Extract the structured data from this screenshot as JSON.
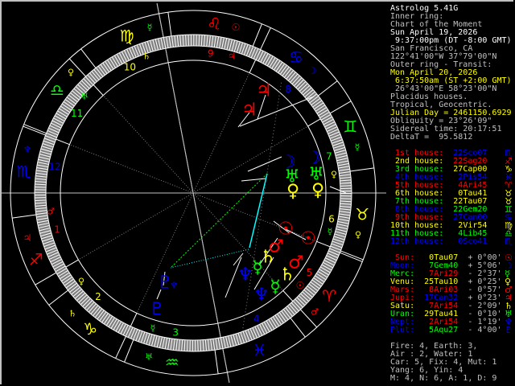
{
  "info": [
    {
      "text": "Astrolog 5.41G",
      "color": "#ffffff"
    },
    {
      "text": "Inner ring:",
      "color": "#c0c0c0"
    },
    {
      "text": "Chart of the Moment",
      "color": "#c0c0c0"
    },
    {
      "text": "Sun April 19, 2026",
      "color": "#ffffff"
    },
    {
      "text": " 9:37:00pm (DT -8:00 GMT)",
      "color": "#ffffff"
    },
    {
      "text": "San Francisco, CA",
      "color": "#c0c0c0"
    },
    {
      "text": "122°41'00\"W 37°79'00\"N",
      "color": "#c0c0c0"
    },
    {
      "text": "Outer ring - Transit:",
      "color": "#c0c0c0"
    },
    {
      "text": "Mon April 20, 2026",
      "color": "#ffff00"
    },
    {
      "text": " 6:37:50am (ST +2:00 GMT)",
      "color": "#ffff00"
    },
    {
      "text": " 26°43'00\"E 58°23'00\"N",
      "color": "#c0c0c0"
    },
    {
      "text": "Placidus houses.",
      "color": "#c0c0c0"
    },
    {
      "text": "Tropical, Geocentric.",
      "color": "#c0c0c0"
    },
    {
      "text": "Julian Day = 2461150.6929",
      "color": "#ffff00"
    },
    {
      "text": "Obliquity = 23°26'09\"",
      "color": "#c0c0c0"
    },
    {
      "text": "Sidereal time: 20:17:51",
      "color": "#c0c0c0"
    },
    {
      "text": "DeltaT =  95.5812",
      "color": "#c0c0c0"
    }
  ],
  "houses": [
    {
      "label": " 1st house:",
      "position": "22Sco07",
      "glyph": "♏",
      "label_color": "#ff0000",
      "value_color": "#0000ff"
    },
    {
      "label": " 2nd house:",
      "position": "22Sag20",
      "glyph": "♐",
      "label_color": "#ffff00",
      "value_color": "#ff0000"
    },
    {
      "label": " 3rd house:",
      "position": "27Cap00",
      "glyph": "♑",
      "label_color": "#00ff00",
      "value_color": "#ffff00"
    },
    {
      "label": " 4th house:",
      "position": "2Pis54",
      "glyph": "♓",
      "label_color": "#0000ff",
      "value_color": "#0000ff"
    },
    {
      "label": " 5th house:",
      "position": "4Ari45",
      "glyph": "♈",
      "label_color": "#ff0000",
      "value_color": "#ff0000"
    },
    {
      "label": " 6th house:",
      "position": "0Tau41",
      "glyph": "♉",
      "label_color": "#ffff00",
      "value_color": "#ffff00"
    },
    {
      "label": " 7th house:",
      "position": "22Tau07",
      "glyph": "♉",
      "label_color": "#00ff00",
      "value_color": "#ffff00"
    },
    {
      "label": " 8th house:",
      "position": "22Gem20",
      "glyph": "♊",
      "label_color": "#0000ff",
      "value_color": "#00ff00"
    },
    {
      "label": " 9th house:",
      "position": "27Can00",
      "glyph": "♋",
      "label_color": "#ff0000",
      "value_color": "#0000ff"
    },
    {
      "label": "10th house:",
      "position": "2Vir54",
      "glyph": "♍",
      "label_color": "#ffff00",
      "value_color": "#ffff00"
    },
    {
      "label": "11th house:",
      "position": "4Lib45",
      "glyph": "♎",
      "label_color": "#00ff00",
      "value_color": "#00ff00"
    },
    {
      "label": "12th house:",
      "position": "0Sco41",
      "glyph": "♏",
      "label_color": "#0000ff",
      "value_color": "#0000ff"
    }
  ],
  "planets": [
    {
      "label": "Sun:",
      "position": "0Tau07",
      "deviation": "+ 0°00'",
      "glyph": "☉",
      "label_color": "#ff0000",
      "value_color": "#ffff00"
    },
    {
      "label": "Moon:",
      "position": "7Gem40",
      "deviation": "+ 5°06'",
      "glyph": "☽",
      "label_color": "#0000ff",
      "value_color": "#00ff00"
    },
    {
      "label": "Merc:",
      "position": "7Ari29",
      "deviation": "- 2°37'",
      "glyph": "☿",
      "label_color": "#00ff00",
      "value_color": "#ff0000"
    },
    {
      "label": "Venu:",
      "position": "25Tau10",
      "deviation": "+ 0°25'",
      "glyph": "♀",
      "label_color": "#ffff00",
      "value_color": "#ffff00"
    },
    {
      "label": "Mars:",
      "position": "8Ari03",
      "deviation": "- 0°57'",
      "glyph": "♂",
      "label_color": "#ff0000",
      "value_color": "#ff0000"
    },
    {
      "label": "Jupi:",
      "position": "17Can32",
      "deviation": "+ 0°23'",
      "glyph": "♃",
      "label_color": "#ff0000",
      "value_color": "#0000ff"
    },
    {
      "label": "Satu:",
      "position": "7Ari54",
      "deviation": "- 2°09'",
      "glyph": "♄",
      "label_color": "#ffff00",
      "value_color": "#ff0000"
    },
    {
      "label": "Uran:",
      "position": "29Tau41",
      "deviation": "- 0°10'",
      "glyph": "♅",
      "label_color": "#00ff00",
      "value_color": "#ffff00"
    },
    {
      "label": "Nept:",
      "position": "2Ari54",
      "deviation": "- 1°19'",
      "glyph": "♆",
      "label_color": "#0000ff",
      "value_color": "#ff0000"
    },
    {
      "label": "Plut:",
      "position": "5Aqu27",
      "deviation": "- 4°00'",
      "glyph": "♇",
      "label_color": "#0000ff",
      "value_color": "#00ff00"
    }
  ],
  "summary": [
    "Fire: 4, Earth: 3,",
    "Air : 2, Water: 1",
    "Car: 5, Fix: 4, Mut: 1",
    "Yang: 6, Yin: 4",
    "M: 4, N: 6, A: 1, D: 9"
  ],
  "chart": {
    "signs": [
      {
        "glyph": "♈",
        "color": "#ff0000"
      },
      {
        "glyph": "♉",
        "color": "#ffff00"
      },
      {
        "glyph": "♊",
        "color": "#00ff00"
      },
      {
        "glyph": "♋",
        "color": "#0000ff"
      },
      {
        "glyph": "♌",
        "color": "#ff0000"
      },
      {
        "glyph": "♍",
        "color": "#ffff00"
      },
      {
        "glyph": "♎",
        "color": "#00ff00"
      },
      {
        "glyph": "♏",
        "color": "#0000ff"
      },
      {
        "glyph": "♐",
        "color": "#ff0000"
      },
      {
        "glyph": "♑",
        "color": "#ffff00"
      },
      {
        "glyph": "♒",
        "color": "#00ff00"
      },
      {
        "glyph": "♓",
        "color": "#0000ff"
      }
    ],
    "house_numbers": [
      "1",
      "2",
      "3",
      "4",
      "5",
      "6",
      "7",
      "8",
      "9",
      "10",
      "11",
      "12"
    ],
    "house_number_colors": [
      "#ff0000",
      "#ffff00",
      "#00ff00",
      "#0000ff",
      "#ff0000",
      "#ffff00",
      "#00ff00",
      "#0000ff",
      "#ff0000",
      "#ffff00",
      "#00ff00",
      "#0000ff"
    ],
    "transit_glyphs": [
      {
        "glyph": "☿",
        "color": "#00ff00"
      },
      {
        "glyph": "☉",
        "color": "#ff0000"
      },
      {
        "glyph": "☽",
        "color": "#0000ff"
      },
      {
        "glyph": "♀",
        "color": "#ffff00"
      },
      {
        "glyph": "♆",
        "color": "#0000ff"
      },
      {
        "glyph": "♃",
        "color": "#ff0000"
      },
      {
        "glyph": "♄",
        "color": "#ffff00"
      },
      {
        "glyph": "♅",
        "color": "#00ff00"
      },
      {
        "glyph": "♂",
        "color": "#ff0000"
      },
      {
        "glyph": "☉",
        "color": "#ff0000"
      },
      {
        "glyph": "♀",
        "color": "#ffff00"
      },
      {
        "glyph": "☿",
        "color": "#00ff00"
      },
      {
        "glyph": "♀",
        "color": "#ffff00"
      },
      {
        "glyph": "☿",
        "color": "#00ff00"
      },
      {
        "glyph": "♃",
        "color": "#ff0000"
      },
      {
        "glyph": "♆",
        "color": "#0000ff"
      },
      {
        "glyph": "♂",
        "color": "#ff0000"
      },
      {
        "glyph": "♀",
        "color": "#ffff00"
      },
      {
        "glyph": "♄",
        "color": "#ffff00"
      },
      {
        "glyph": "☿",
        "color": "#00ff00"
      },
      {
        "glyph": "♅",
        "color": "#00ff00"
      }
    ],
    "planet_glyphs": [
      {
        "glyph": "☽",
        "color": "#0000ff"
      },
      {
        "glyph": "☽",
        "color": "#0000ff"
      },
      {
        "glyph": "♅",
        "color": "#00ff00"
      },
      {
        "glyph": "♅",
        "color": "#00ff00"
      },
      {
        "glyph": "♀",
        "color": "#ffff00"
      },
      {
        "glyph": "♀",
        "color": "#ffff00"
      },
      {
        "glyph": "☉",
        "color": "#ff0000"
      },
      {
        "glyph": "☉",
        "color": "#ff0000"
      },
      {
        "glyph": "♂",
        "color": "#ff0000"
      },
      {
        "glyph": "♂",
        "color": "#ff0000"
      },
      {
        "glyph": "♄",
        "color": "#ffff00"
      },
      {
        "glyph": "♄",
        "color": "#ffff00"
      },
      {
        "glyph": "☿",
        "color": "#00ff00"
      },
      {
        "glyph": "☿",
        "color": "#00ff00"
      },
      {
        "glyph": "♆",
        "color": "#0000ff"
      },
      {
        "glyph": "♆",
        "color": "#0000ff"
      },
      {
        "glyph": "♇",
        "color": "#0000ff"
      },
      {
        "glyph": "♇",
        "color": "#0000ff"
      },
      {
        "glyph": "♃",
        "color": "#ff0000"
      },
      {
        "glyph": "♃",
        "color": "#ff0000"
      }
    ]
  }
}
